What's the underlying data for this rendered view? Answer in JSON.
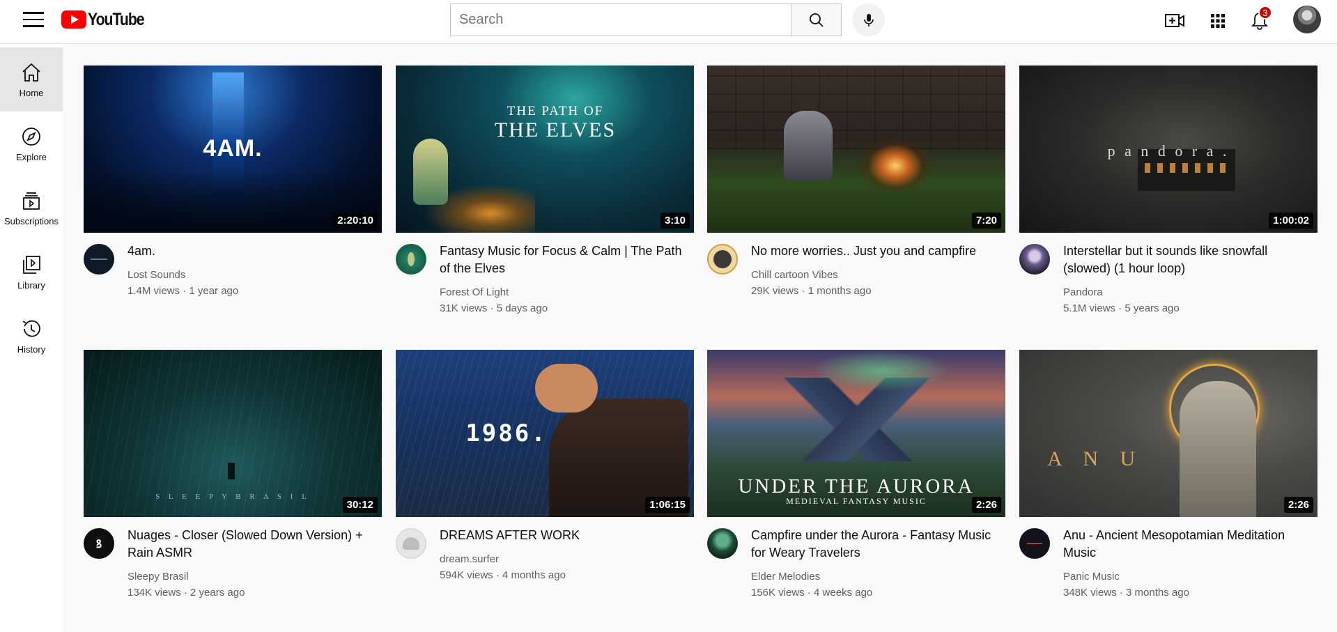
{
  "header": {
    "logo_text": "YouTube",
    "search_placeholder": "Search",
    "notification_count": "3"
  },
  "sidebar": {
    "items": [
      {
        "label": "Home",
        "icon": "home-icon",
        "active": true
      },
      {
        "label": "Explore",
        "icon": "compass-icon",
        "active": false
      },
      {
        "label": "Subscriptions",
        "icon": "subscriptions-icon",
        "active": false
      },
      {
        "label": "Library",
        "icon": "library-icon",
        "active": false
      },
      {
        "label": "History",
        "icon": "history-icon",
        "active": false
      }
    ]
  },
  "videos": [
    {
      "title": "4am.",
      "channel": "Lost Sounds",
      "views": "1.4M views",
      "age": "1 year ago",
      "meta": "1.4M views · 1 year ago",
      "duration": "2:20:10",
      "thumb_text": "4AM."
    },
    {
      "title": "Fantasy Music for Focus & Calm | The Path of the Elves",
      "channel": "Forest Of Light",
      "views": "31K views",
      "age": "5 days ago",
      "meta": "31K views · 5 days ago",
      "duration": "3:10",
      "thumb_text_1": "THE PATH OF",
      "thumb_text_2": "THE ELVES"
    },
    {
      "title": "No more worries.. Just you and campfire",
      "channel": "Chill cartoon Vibes",
      "views": "29K views",
      "age": "1 months ago",
      "meta": "29K views · 1 months ago",
      "duration": "7:20"
    },
    {
      "title": "Interstellar but it sounds like snowfall (slowed) (1 hour loop)",
      "channel": "Pandora",
      "views": "5.1M views",
      "age": "5 years ago",
      "meta": "5.1M views · 5 years ago",
      "duration": "1:00:02",
      "thumb_text": "p a n d o r a ."
    },
    {
      "title": "Nuages - Closer (Slowed Down Version) + Rain ASMR",
      "channel": "Sleepy Brasil",
      "views": "134K views",
      "age": "2 years ago",
      "meta": "134K views · 2 years ago",
      "duration": "30:12",
      "thumb_text": "S L E E P Y   B R A S I L"
    },
    {
      "title": "DREAMS AFTER WORK",
      "channel": "dream.surfer",
      "views": "594K views",
      "age": "4 months ago",
      "meta": "594K views · 4 months ago",
      "duration": "1:06:15",
      "thumb_text": "1986."
    },
    {
      "title": "Campfire under the Aurora - Fantasy Music for Weary Travelers",
      "channel": "Elder Melodies",
      "views": "156K views",
      "age": "4 weeks ago",
      "meta": "156K views · 4 weeks ago",
      "duration": "2:26",
      "thumb_text_1": "UNDER THE AURORA",
      "thumb_text_2": "MEDIEVAL FANTASY MUSIC"
    },
    {
      "title": "Anu - Ancient Mesopotamian Meditation Music",
      "channel": "Panic Music",
      "views": "348K views",
      "age": "3 months ago",
      "meta": "348K views · 3 months ago",
      "duration": "2:26",
      "thumb_text": "A N U"
    }
  ]
}
